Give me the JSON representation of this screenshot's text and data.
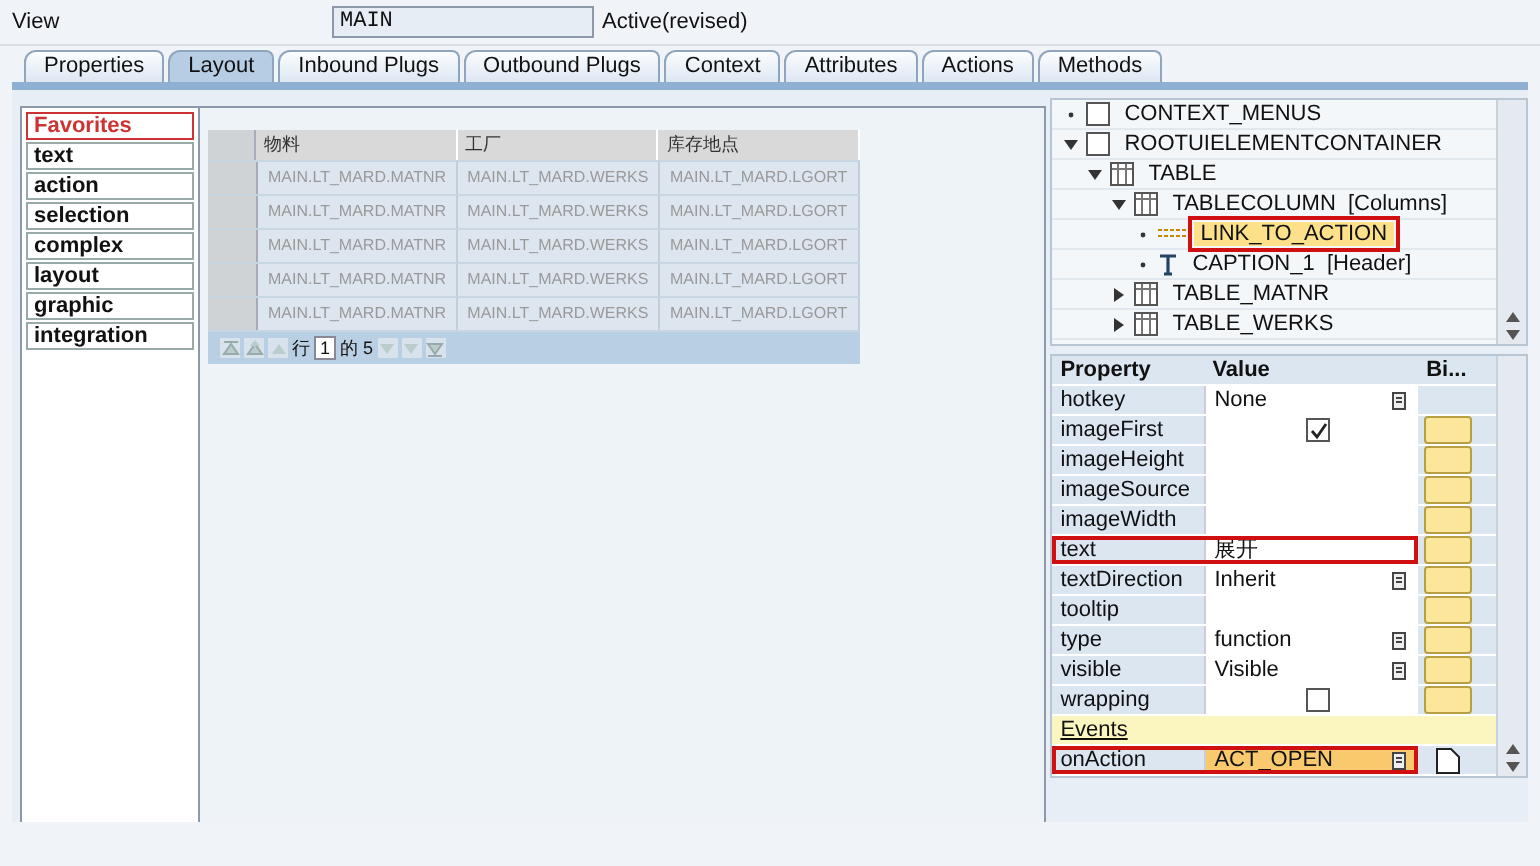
{
  "header": {
    "label": "View",
    "name": "MAIN",
    "status": "Active(revised)"
  },
  "tabs": [
    {
      "label": "Properties",
      "selected": false
    },
    {
      "label": "Layout",
      "selected": true
    },
    {
      "label": "Inbound Plugs",
      "selected": false
    },
    {
      "label": "Outbound Plugs",
      "selected": false
    },
    {
      "label": "Context",
      "selected": false
    },
    {
      "label": "Attributes",
      "selected": false
    },
    {
      "label": "Actions",
      "selected": false
    },
    {
      "label": "Methods",
      "selected": false
    }
  ],
  "palette": [
    {
      "label": "Favorites",
      "selected": true
    },
    {
      "label": "text",
      "selected": false
    },
    {
      "label": "action",
      "selected": false
    },
    {
      "label": "selection",
      "selected": false
    },
    {
      "label": "complex",
      "selected": false
    },
    {
      "label": "layout",
      "selected": false
    },
    {
      "label": "graphic",
      "selected": false
    },
    {
      "label": "integration",
      "selected": false
    }
  ],
  "table": {
    "columns": [
      "物料",
      "工厂",
      "库存地点"
    ],
    "rows": [
      [
        "MAIN.LT_MARD.MATNR",
        "MAIN.LT_MARD.WERKS",
        "MAIN.LT_MARD.LGORT"
      ],
      [
        "MAIN.LT_MARD.MATNR",
        "MAIN.LT_MARD.WERKS",
        "MAIN.LT_MARD.LGORT"
      ],
      [
        "MAIN.LT_MARD.MATNR",
        "MAIN.LT_MARD.WERKS",
        "MAIN.LT_MARD.LGORT"
      ],
      [
        "MAIN.LT_MARD.MATNR",
        "MAIN.LT_MARD.WERKS",
        "MAIN.LT_MARD.LGORT"
      ],
      [
        "MAIN.LT_MARD.MATNR",
        "MAIN.LT_MARD.WERKS",
        "MAIN.LT_MARD.LGORT"
      ]
    ],
    "pager": {
      "row_label": "行",
      "row_value": "1",
      "of_label": "的 5"
    }
  },
  "tree": [
    {
      "label": "CONTEXT_MENUS",
      "kind": "container",
      "expanded": false,
      "selected": false,
      "highlighted": false
    },
    {
      "label": "ROOTUIELEMENTCONTAINER",
      "kind": "container",
      "expanded": true,
      "selected": false,
      "highlighted": false,
      "children": [
        {
          "label": "TABLE",
          "kind": "table",
          "expanded": true,
          "selected": false,
          "highlighted": false,
          "children": [
            {
              "label": "TABLECOLUMN",
              "suffix": "[Columns]",
              "kind": "table",
              "expanded": true,
              "selected": false,
              "highlighted": false,
              "children": [
                {
                  "label": "LINK_TO_ACTION",
                  "kind": "link",
                  "expanded": false,
                  "selected": true,
                  "highlighted": true
                },
                {
                  "label": "CAPTION_1",
                  "suffix": "[Header]",
                  "kind": "caption",
                  "expanded": false,
                  "selected": false,
                  "highlighted": false
                }
              ]
            },
            {
              "label": "TABLE_MATNR",
              "kind": "table",
              "expanded": false,
              "selected": false,
              "highlighted": false,
              "collapsed_children": true
            },
            {
              "label": "TABLE_WERKS",
              "kind": "table",
              "expanded": false,
              "selected": false,
              "highlighted": false,
              "collapsed_children": true
            }
          ]
        }
      ]
    }
  ],
  "properties": {
    "columns": [
      "Property",
      "Value",
      "Bi..."
    ],
    "rows": [
      {
        "property": "hotkey",
        "kind": "dropdown",
        "value": "None",
        "highlighted": false,
        "binding": false
      },
      {
        "property": "imageFirst",
        "kind": "checkbox",
        "checked": true,
        "highlighted": false,
        "binding": true
      },
      {
        "property": "imageHeight",
        "kind": "text",
        "value": "",
        "highlighted": false,
        "binding": true
      },
      {
        "property": "imageSource",
        "kind": "text",
        "value": "",
        "highlighted": false,
        "binding": true
      },
      {
        "property": "imageWidth",
        "kind": "text",
        "value": "",
        "highlighted": false,
        "binding": true
      },
      {
        "property": "text",
        "kind": "text",
        "value": "展开",
        "highlighted": true,
        "binding": true
      },
      {
        "property": "textDirection",
        "kind": "dropdown",
        "value": "Inherit",
        "highlighted": false,
        "binding": true
      },
      {
        "property": "tooltip",
        "kind": "text",
        "value": "",
        "highlighted": false,
        "binding": true
      },
      {
        "property": "type",
        "kind": "dropdown",
        "value": "function",
        "highlighted": false,
        "binding": true
      },
      {
        "property": "visible",
        "kind": "dropdown",
        "value": "Visible",
        "highlighted": false,
        "binding": true
      },
      {
        "property": "wrapping",
        "kind": "checkbox",
        "checked": false,
        "highlighted": false,
        "binding": true
      },
      {
        "kind": "section",
        "property": "Events"
      },
      {
        "property": "onAction",
        "kind": "event",
        "value": "ACT_OPEN",
        "highlighted": true,
        "binding": false
      }
    ]
  }
}
